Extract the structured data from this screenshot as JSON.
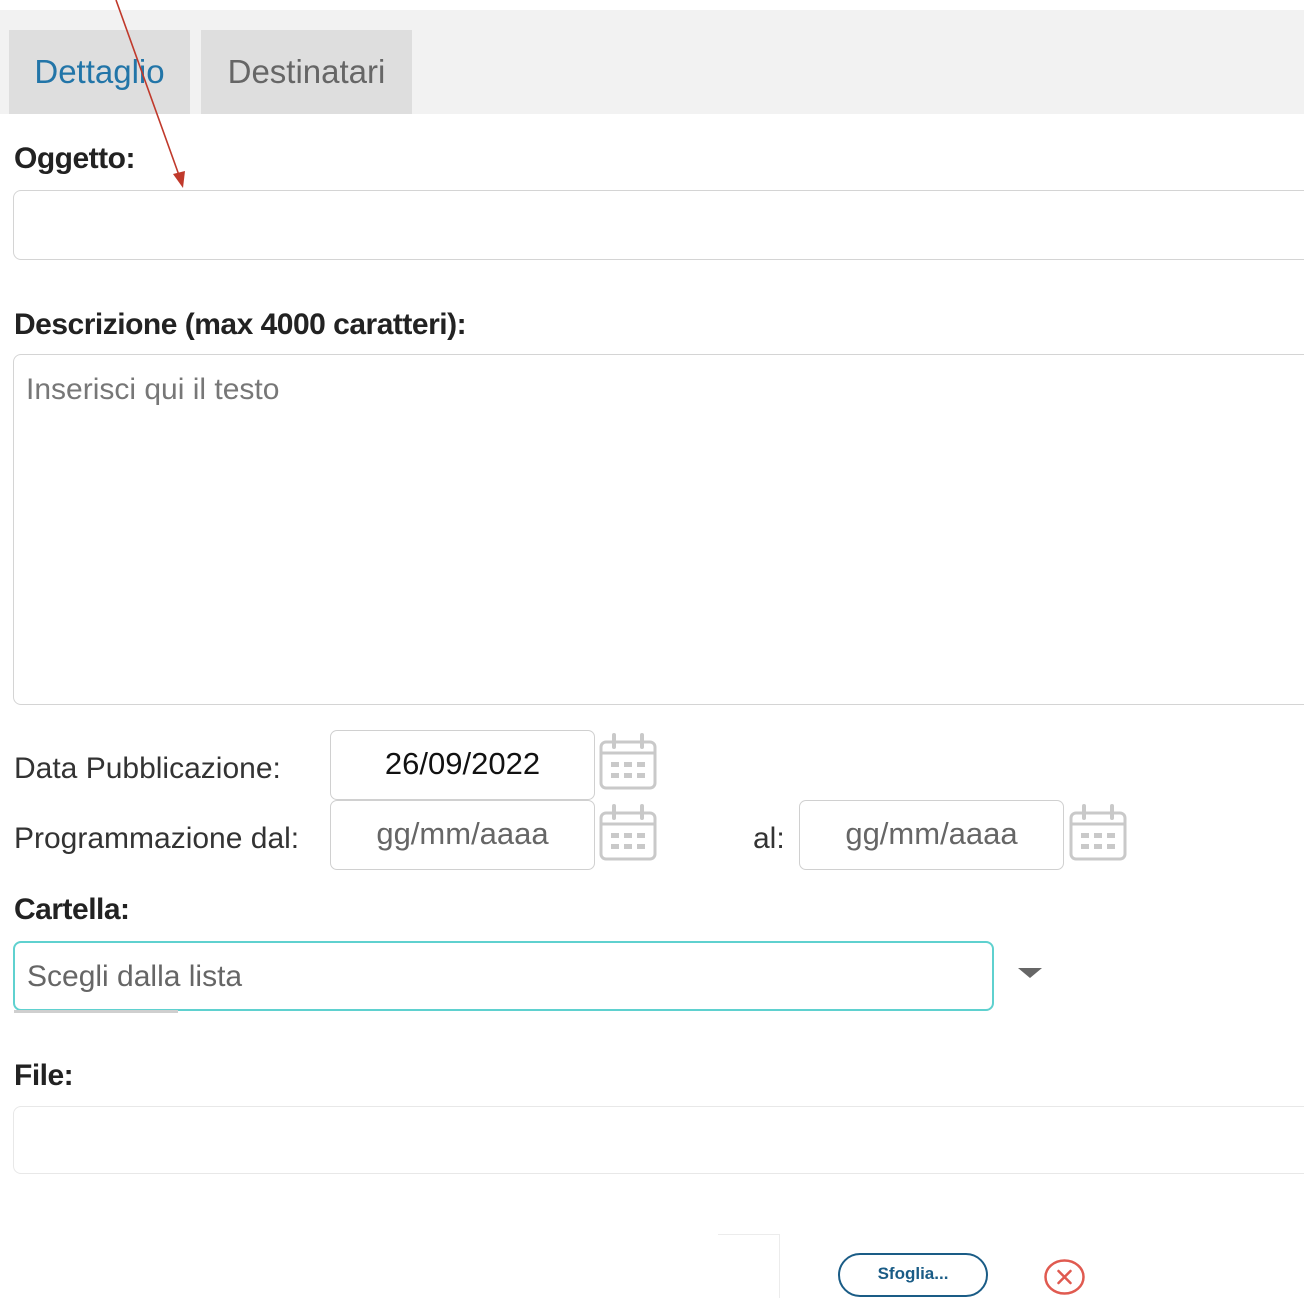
{
  "tabs": {
    "dettaglio": "Dettaglio",
    "destinatari": "Destinatari"
  },
  "form": {
    "oggetto_label": "Oggetto:",
    "oggetto_value": "",
    "descrizione_label": "Descrizione (max 4000 caratteri):",
    "descrizione_placeholder": "Inserisci qui il testo",
    "data_pubblicazione_label": "Data Pubblicazione:",
    "data_pubblicazione_value": "26/09/2022",
    "programmazione_dal_label": "Programmazione dal:",
    "programmazione_dal_placeholder": "gg/mm/aaaa",
    "al_label": "al:",
    "al_placeholder": "gg/mm/aaaa",
    "cartella_label": "Cartella:",
    "cartella_placeholder": "Scegli dalla lista",
    "file_label": "File:",
    "sfoglia_label": "Sfoglia..."
  },
  "colors": {
    "active_tab": "#2275a8",
    "select_border": "#5fd1cf",
    "sfoglia_border": "#1a5c86",
    "close_icon": "#e05a50",
    "annotation_arrow": "#c0392b"
  },
  "icons": [
    "calendar-icon",
    "chevron-down-icon",
    "close-circle-icon",
    "arrow-annotation"
  ]
}
